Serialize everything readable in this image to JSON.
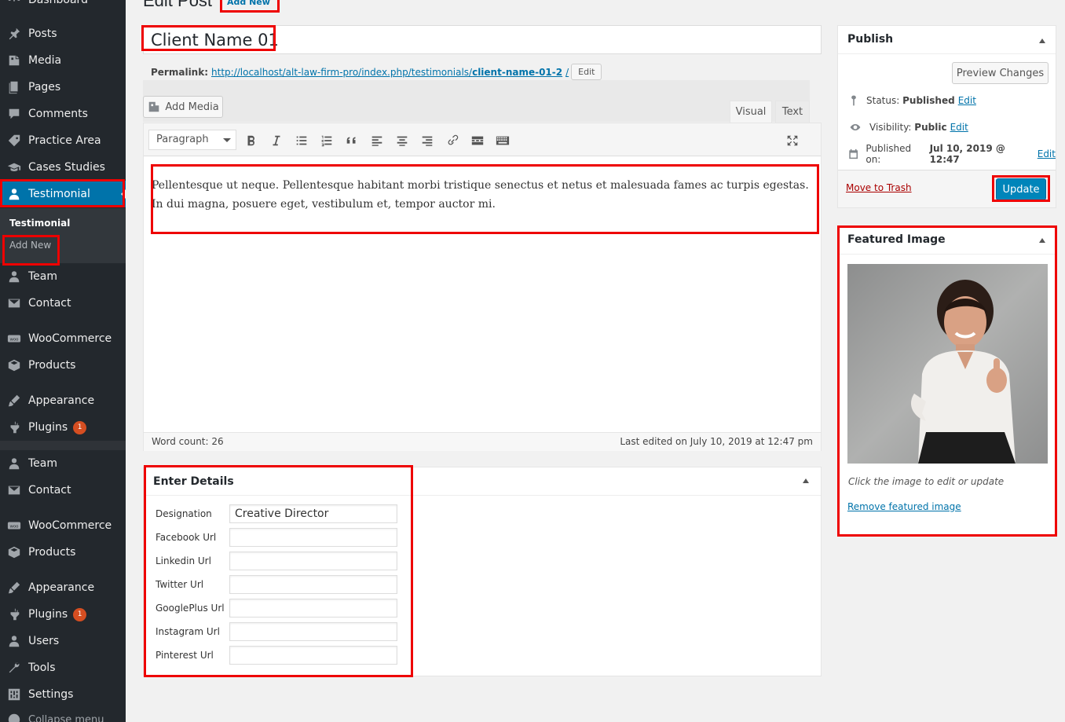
{
  "sidebar": {
    "items": [
      {
        "label": "Dashboard",
        "icon": "dashboard-icon"
      },
      {
        "label": "Posts",
        "icon": "pin-icon"
      },
      {
        "label": "Media",
        "icon": "media-icon"
      },
      {
        "label": "Pages",
        "icon": "pages-icon"
      },
      {
        "label": "Comments",
        "icon": "comments-icon"
      },
      {
        "label": "Practice Area",
        "icon": "tag-icon"
      },
      {
        "label": "Cases Studies",
        "icon": "graduation-cap-icon"
      },
      {
        "label": "Testimonial",
        "icon": "user-icon"
      },
      {
        "label": "Team",
        "icon": "user-icon"
      },
      {
        "label": "Contact",
        "icon": "envelope-icon"
      },
      {
        "label": "WooCommerce",
        "icon": "woo-icon"
      },
      {
        "label": "Products",
        "icon": "box-icon"
      },
      {
        "label": "Appearance",
        "icon": "brush-icon"
      },
      {
        "label": "Plugins",
        "icon": "plugin-icon",
        "badge": "1"
      },
      {
        "label": "Team",
        "icon": "user-icon"
      },
      {
        "label": "Contact",
        "icon": "envelope-icon"
      },
      {
        "label": "WooCommerce",
        "icon": "woo-icon"
      },
      {
        "label": "Products",
        "icon": "box-icon"
      },
      {
        "label": "Appearance",
        "icon": "brush-icon"
      },
      {
        "label": "Plugins",
        "icon": "plugin-icon",
        "badge": "1"
      },
      {
        "label": "Users",
        "icon": "users-icon"
      },
      {
        "label": "Tools",
        "icon": "wrench-icon"
      },
      {
        "label": "Settings",
        "icon": "settings-icon"
      },
      {
        "label": "Collapse menu",
        "icon": "collapse-icon"
      }
    ],
    "submenu": {
      "title": "Testimonial",
      "add_new": "Add New"
    }
  },
  "header": {
    "title": "Edit Post",
    "add_new": "Add New"
  },
  "post": {
    "title": "Client Name 01",
    "permalink_label": "Permalink:",
    "permalink_base": "http://localhost/alt-law-firm-pro/index.php/testimonials/",
    "permalink_slug": "client-name-01-2",
    "permalink_trail": "/",
    "permalink_edit": "Edit"
  },
  "editor": {
    "add_media": "Add Media",
    "tab_visual": "Visual",
    "tab_text": "Text",
    "format_select": "Paragraph",
    "content": "Pellentesque ut neque. Pellentesque habitant morbi tristique senectus et netus et malesuada fames ac turpis egestas. In dui magna, posuere eget, vestibulum et, tempor auctor mi.",
    "word_count": "Word count: 26",
    "last_edited": "Last edited on July 10, 2019 at 12:47 pm"
  },
  "details": {
    "title": "Enter Details",
    "fields": [
      {
        "label": "Designation",
        "value": "Creative Director"
      },
      {
        "label": "Facebook Url",
        "value": ""
      },
      {
        "label": "Linkedin Url",
        "value": ""
      },
      {
        "label": "Twitter Url",
        "value": ""
      },
      {
        "label": "GooglePlus Url",
        "value": ""
      },
      {
        "label": "Instagram Url",
        "value": ""
      },
      {
        "label": "Pinterest Url",
        "value": ""
      }
    ]
  },
  "publish": {
    "title": "Publish",
    "preview": "Preview Changes",
    "status_label": "Status:",
    "status_value": "Published",
    "visibility_label": "Visibility:",
    "visibility_value": "Public",
    "published_label": "Published on:",
    "published_value": "Jul 10, 2019 @ 12:47",
    "edit": "Edit",
    "trash": "Move to Trash",
    "update": "Update"
  },
  "featured": {
    "title": "Featured Image",
    "hint": "Click the image to edit or update",
    "remove": "Remove featured image"
  },
  "colors": {
    "accent": "#0073aa",
    "sidebar": "#23282d",
    "highlight": "#e00000"
  }
}
